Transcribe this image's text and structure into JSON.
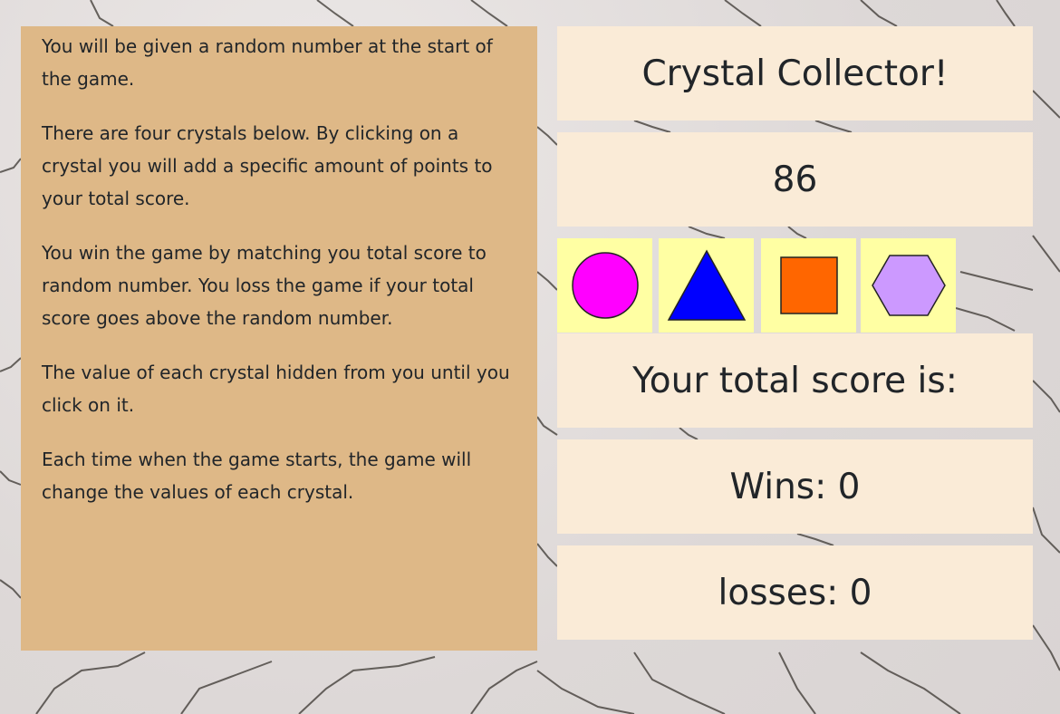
{
  "instructions": [
    "You will be given a random number at the start of the game.",
    "There are four crystals below. By clicking on a crystal you will add a specific amount of points to your total score.",
    "You win the game by matching you total score to random number. You loss the game if your total score goes above the random number.",
    "The value of each crystal hidden from you until you click on it.",
    "Each time when the game starts, the game will change the values of each crystal."
  ],
  "game": {
    "title": "Crystal Collector!",
    "random_number": "86",
    "total_score_label": "Your total score is:",
    "wins_label": "Wins: 0",
    "losses_label": "losses: 0"
  },
  "crystals": [
    {
      "name": "circle-crystal",
      "color": "#ff00ff"
    },
    {
      "name": "triangle-crystal",
      "color": "#0000ff"
    },
    {
      "name": "square-crystal",
      "color": "#ff6600"
    },
    {
      "name": "hexagon-crystal",
      "color": "#cc99ff"
    }
  ]
}
